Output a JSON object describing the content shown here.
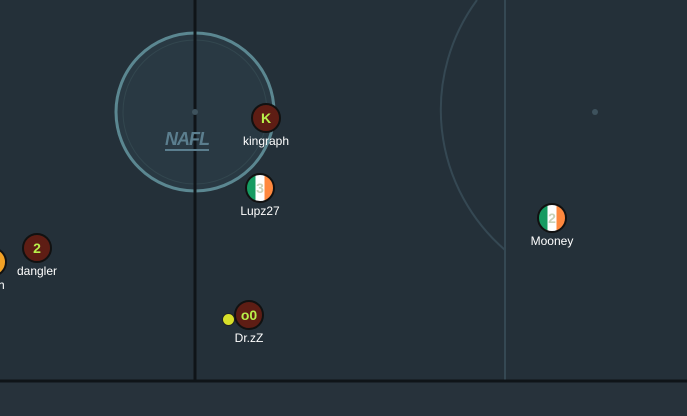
{
  "logo": {
    "text": "NAFL"
  },
  "players": [
    {
      "id": "kingraph",
      "name": "kingraph",
      "badge": "K",
      "style": "maroon"
    },
    {
      "id": "lupz27",
      "name": "Lupz27",
      "badge": "3",
      "style": "flag"
    },
    {
      "id": "dangler",
      "name": "dangler",
      "badge": "2",
      "style": "maroon"
    },
    {
      "id": "drzz",
      "name": "Dr.zZ",
      "badge": "o0",
      "style": "maroon"
    },
    {
      "id": "mooney",
      "name": "Mooney",
      "badge": "2",
      "style": "flag"
    },
    {
      "id": "offscreen",
      "name": "ph",
      "badge": "",
      "style": "orange"
    }
  ],
  "colors": {
    "pitch": "#243039",
    "line": "#0f1418",
    "circle": "#5e8c96",
    "maroon": "#5e1d14",
    "badge_text": "#b8f04a",
    "ball": "#d8e02a"
  }
}
